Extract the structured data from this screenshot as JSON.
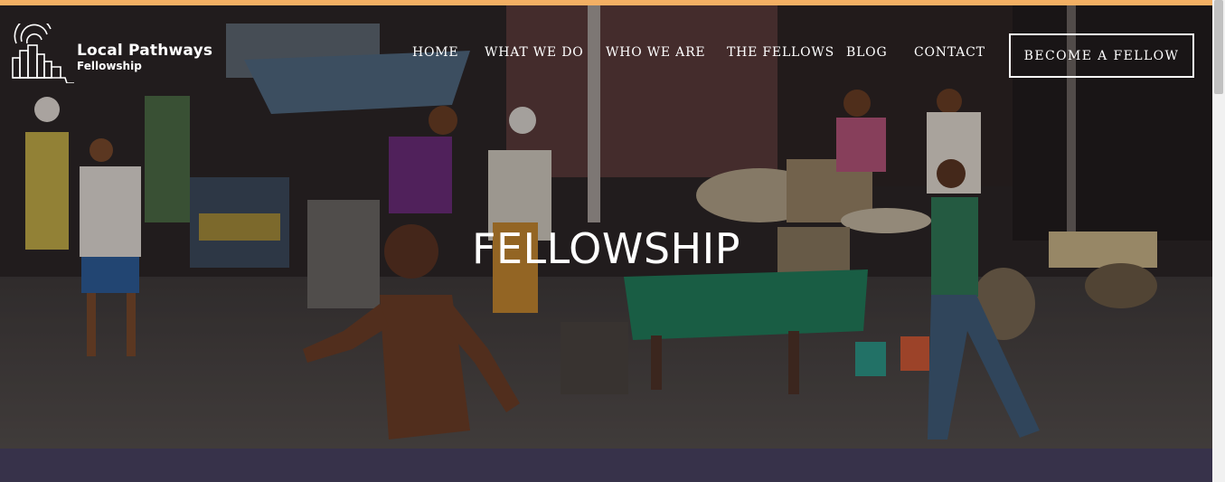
{
  "colors": {
    "top_accent": "#f3b064",
    "band": "#37324a",
    "text": "#ffffff"
  },
  "logo": {
    "name": "Local Pathways",
    "subname": "Fellowship",
    "icon": "city-skyline-signal-icon"
  },
  "nav": {
    "items": [
      {
        "label": "HOME"
      },
      {
        "label": "WHAT WE DO"
      },
      {
        "label": "WHO WE ARE"
      },
      {
        "label": "THE FELLOWS"
      },
      {
        "label": "BLOG"
      },
      {
        "label": "CONTACT"
      }
    ],
    "cta_label": "BECOME A FELLOW"
  },
  "hero": {
    "title": "FELLOWSHIP",
    "background": "street-market-photo"
  }
}
